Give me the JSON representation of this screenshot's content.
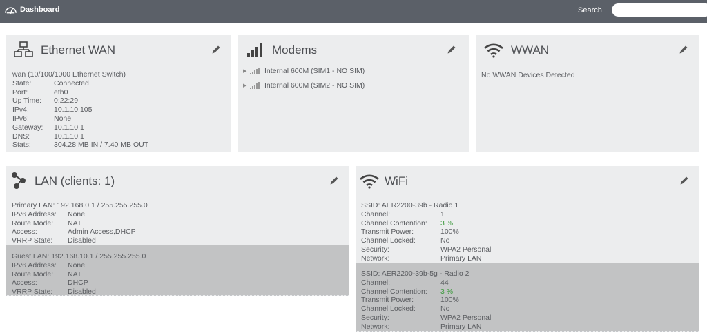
{
  "topbar": {
    "title": "Dashboard",
    "search_label": "Search",
    "search_value": ""
  },
  "ethernet_wan": {
    "title": "Ethernet WAN",
    "heading": "wan (10/100/1000 Ethernet Switch)",
    "rows": [
      {
        "k": "State:",
        "v": "Connected"
      },
      {
        "k": "Port:",
        "v": "eth0"
      },
      {
        "k": "Up Time:",
        "v": "0:22:29"
      },
      {
        "k": "IPv4:",
        "v": "10.1.10.105"
      },
      {
        "k": "IPv6:",
        "v": "None"
      },
      {
        "k": "Gateway:",
        "v": "10.1.10.1"
      },
      {
        "k": "DNS:",
        "v": "10.1.10.1"
      },
      {
        "k": "Stats:",
        "v": "304.28 MB IN / 7.40 MB OUT"
      }
    ]
  },
  "modems": {
    "title": "Modems",
    "items": [
      "Internal 600M (SIM1 - NO SIM)",
      "Internal 600M (SIM2 - NO SIM)"
    ]
  },
  "wwan": {
    "title": "WWAN",
    "message": "No WWAN Devices Detected"
  },
  "lan": {
    "title": "LAN (clients: 1)",
    "networks": [
      {
        "heading": "Primary LAN: 192.168.0.1 / 255.255.255.0",
        "rows": [
          {
            "k": "IPv6 Address:",
            "v": "None"
          },
          {
            "k": "Route Mode:",
            "v": "NAT"
          },
          {
            "k": "Access:",
            "v": "Admin Access,DHCP"
          },
          {
            "k": "VRRP State:",
            "v": "Disabled"
          }
        ]
      },
      {
        "heading": "Guest LAN: 192.168.10.1 / 255.255.255.0",
        "rows": [
          {
            "k": "IPv6 Address:",
            "v": "None"
          },
          {
            "k": "Route Mode:",
            "v": "NAT"
          },
          {
            "k": "Access:",
            "v": "DHCP"
          },
          {
            "k": "VRRP State:",
            "v": "Disabled"
          }
        ]
      }
    ]
  },
  "wifi": {
    "title": "WiFi",
    "radios": [
      {
        "heading": "SSID: AER2200-39b - Radio 1",
        "rows": [
          {
            "k": "Channel:",
            "v": "1"
          },
          {
            "k": "Channel Contention:",
            "v": "3 %"
          },
          {
            "k": "Transmit Power:",
            "v": "100%"
          },
          {
            "k": "Channel Locked:",
            "v": "No"
          },
          {
            "k": "Security:",
            "v": "WPA2 Personal"
          },
          {
            "k": "Network:",
            "v": "Primary LAN"
          }
        ]
      },
      {
        "heading": "SSID: AER2200-39b-5g - Radio 2",
        "rows": [
          {
            "k": "Channel:",
            "v": "44"
          },
          {
            "k": "Channel Contention:",
            "v": "3 %"
          },
          {
            "k": "Transmit Power:",
            "v": "100%"
          },
          {
            "k": "Channel Locked:",
            "v": "No"
          },
          {
            "k": "Security:",
            "v": "WPA2 Personal"
          },
          {
            "k": "Network:",
            "v": "Primary LAN"
          }
        ]
      }
    ]
  },
  "colors": {
    "topbar": "#5b6068",
    "card": "#ecedee",
    "alt_block": "#c2c3c4",
    "good": "#3c9a3c"
  },
  "icons": [
    "dashboard-gauge-icon",
    "network-topology-icon",
    "signal-bars-icon",
    "wifi-icon",
    "share-nodes-icon",
    "pencil-edit-icon",
    "expand-triangle-icon"
  ]
}
